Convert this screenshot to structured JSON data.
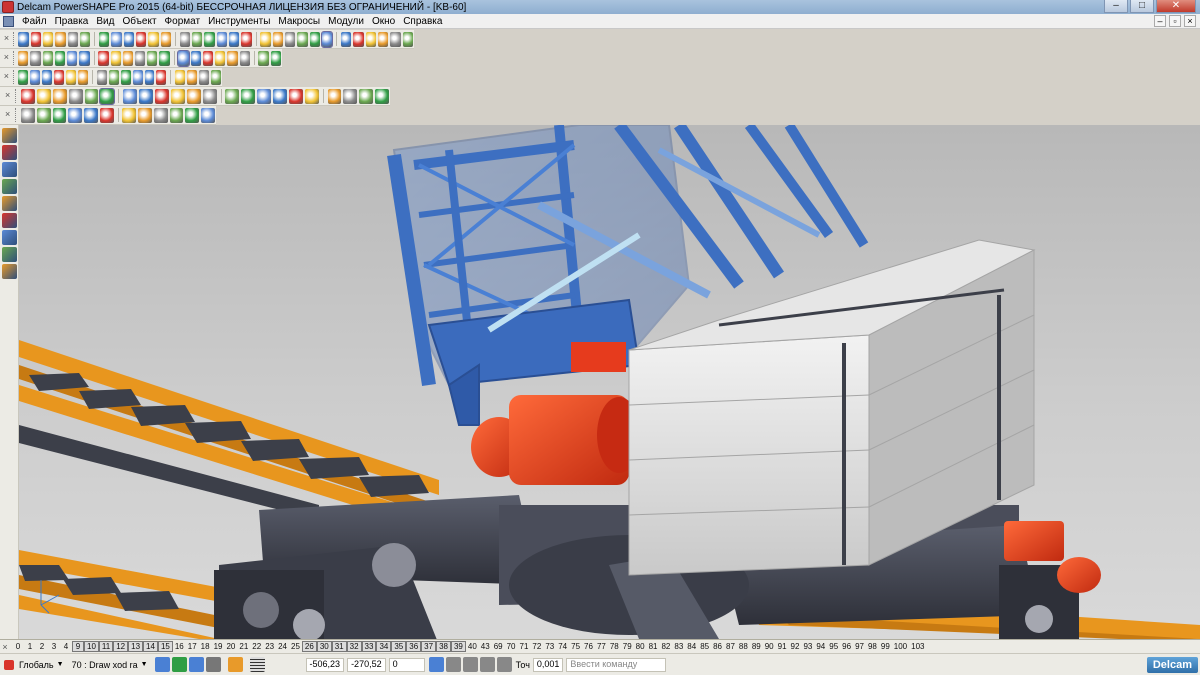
{
  "window": {
    "title": "Delcam PowerSHAPE Pro 2015 (64-bit) БЕССРОЧНАЯ ЛИЦЕНЗИЯ БЕЗ ОГРАНИЧЕНИЙ - [KB-60]",
    "controls": {
      "minimize": "–",
      "maximize": "□",
      "close": "✕"
    }
  },
  "menu": {
    "items": [
      "Файл",
      "Правка",
      "Вид",
      "Объект",
      "Формат",
      "Инструменты",
      "Макросы",
      "Модули",
      "Окно",
      "Справка"
    ],
    "mdi_controls": [
      "–",
      "▫",
      "×"
    ]
  },
  "toolbars": {
    "rows": [
      {
        "icons": 30,
        "selected": [
          23
        ]
      },
      {
        "icons": 20,
        "selected": [
          12
        ]
      },
      {
        "icons": 16,
        "selected": []
      },
      {
        "icons": 22,
        "selected": [
          5
        ]
      },
      {
        "icons": 12,
        "selected": []
      }
    ],
    "left_tools": 9,
    "colors": {
      "accent": "#3a78c8",
      "orange": "#e89a2a",
      "green": "#2f9e44",
      "red": "#d9342b"
    }
  },
  "viewport": {
    "model": "KB-60",
    "background_top": "#b8b8b8",
    "background_bottom": "#d9d9d9",
    "colors": {
      "jib": "#3d6fc1",
      "rails": "#e8961e",
      "motors": "#e63b1d",
      "counterweight": "#d5d5d5",
      "frame": "#4a4d5a"
    }
  },
  "levels": {
    "close": "×",
    "items": [
      "0",
      "1",
      "2",
      "3",
      "4",
      "9",
      "10",
      "11",
      "12",
      "13",
      "14",
      "15",
      "16",
      "17",
      "18",
      "19",
      "20",
      "21",
      "22",
      "23",
      "24",
      "25",
      "26",
      "30",
      "31",
      "32",
      "33",
      "34",
      "35",
      "36",
      "37",
      "38",
      "39",
      "40",
      "43",
      "69",
      "70",
      "71",
      "72",
      "73",
      "74",
      "75",
      "76",
      "77",
      "78",
      "79",
      "80",
      "81",
      "82",
      "83",
      "84",
      "85",
      "86",
      "87",
      "88",
      "89",
      "90",
      "91",
      "92",
      "93",
      "94",
      "95",
      "96",
      "97",
      "98",
      "99",
      "100",
      "103"
    ],
    "active": [
      "9",
      "10",
      "11",
      "12",
      "13",
      "14",
      "15",
      "26",
      "30",
      "31",
      "32",
      "33",
      "34",
      "35",
      "36",
      "37",
      "38",
      "39"
    ]
  },
  "status": {
    "workplane": "Глобаль",
    "level": "70 : Draw xod ra",
    "x": "-506,23",
    "y": "-270,52",
    "z": "0",
    "tolerance_label": "Точ",
    "tolerance": "0,001",
    "command_placeholder": "Ввести команду",
    "logo": "Delcam"
  }
}
